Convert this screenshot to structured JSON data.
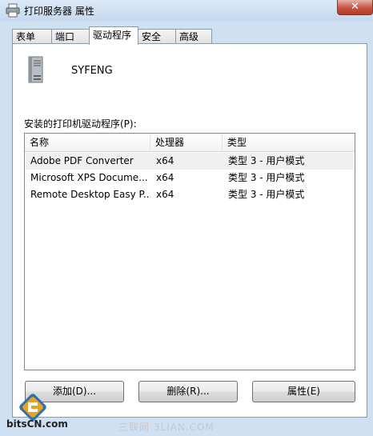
{
  "window": {
    "title": "打印服务器 属性",
    "close_glyph": "✕"
  },
  "tabs": [
    {
      "label": "表单"
    },
    {
      "label": "端口"
    },
    {
      "label": "驱动程序",
      "active": true
    },
    {
      "label": "安全"
    },
    {
      "label": "高级"
    }
  ],
  "server": {
    "name": "SYFENG",
    "icon": "server-icon"
  },
  "drivers": {
    "label": "安装的打印机驱动程序(P):",
    "columns": [
      "名称",
      "处理器",
      "类型"
    ],
    "rows": [
      {
        "name": "Adobe PDF Converter",
        "processor": "x64",
        "type": "类型 3 - 用户模式"
      },
      {
        "name": "Microsoft XPS Docume...",
        "processor": "x64",
        "type": "类型 3 - 用户模式"
      },
      {
        "name": "Remote Desktop Easy P...",
        "processor": "x64",
        "type": "类型 3 - 用户模式"
      }
    ]
  },
  "buttons": {
    "add": "添加(D)...",
    "remove": "删除(R)...",
    "properties": "属性(E)"
  },
  "watermark": {
    "left_text": "bitsCN.com",
    "right_text": "三联网 3LIAN.COM"
  },
  "colors": {
    "titlebar": "#c6d9ef",
    "close_button": "#c7533f"
  }
}
